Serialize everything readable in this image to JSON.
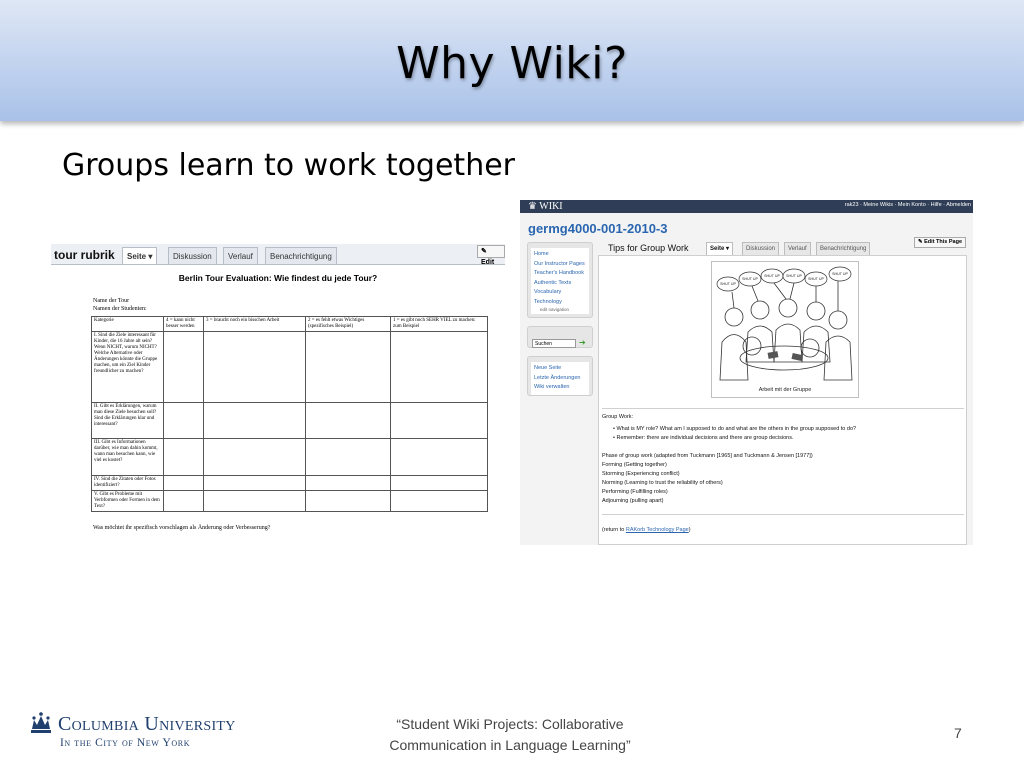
{
  "slide": {
    "title": "Why Wiki?",
    "bullet": "Groups learn to work together",
    "footer_line1": "“Student Wiki Projects:  Collaborative",
    "footer_line2": "Communication in Language Learning”",
    "page_number": "7",
    "logo_line1": "Columbia University",
    "logo_line2": "In the City of New York",
    "colors": {
      "title_band": "#bed1ef",
      "logo": "#1f3f6e",
      "wiki_blue": "#2a66b0"
    }
  },
  "left_screenshot": {
    "page_name": "tour rubrik",
    "tabs": [
      "Seite",
      "Diskussion",
      "Verlauf",
      "Benachrichtigung"
    ],
    "edit_label": "Edit",
    "heading": "Berlin Tour Evaluation: Wie findest du jede Tour?",
    "meta": [
      "Name der Tour",
      "Namen der Studenten:"
    ],
    "table": {
      "headers": [
        "Kategorie",
        "4 = kann nicht besser werden",
        "3 = braucht noch ein bisschen Arbeit",
        "2 = es fehlt etwas Wichtiges (spezifisches Beispiel)",
        "1 = es gibt noch SEHR VIEL zu machen: zum Beispiel"
      ],
      "rows": [
        "I.  Sind die Ziele interessant für Kinder, die 16 Jahre alt sein? Wenn NICHT, warum NICHT?  Welche Alternative oder Änderungen könnte die Gruppe machen, um ein Ziel Kinder freundlicher zu machen?",
        "II.  Gibt es Erklärungen, warum man diese Ziele besuchen soll?  Sind die Erklärungen klar und interessant?",
        "III.  Gibt es Informationen darüber, wie man dahin kommt, wann man besuchen kann, wie viel es kostet?",
        "IV.  Sind die Zitaten oder Fotos identifiziert?",
        "V.  Gibt es Probleme mit Verbformen oder Formen in dem Text?"
      ]
    },
    "footer": "Was möchtet ihr spezifisch vorschlagen als Änderung oder Verbesserung?"
  },
  "right_screenshot": {
    "logo": "WIKI",
    "user_bar": "rak23 · Meine Wikis · Mein Konto · Hilfe · Abmelden",
    "wiki_title": "germg4000-001-2010-3",
    "nav_links": [
      "Home",
      "Our Instructor Pages",
      "Teacher's Handbook",
      "Authentic Texts",
      "Vocabulary",
      "Technology"
    ],
    "edit_navigation": "edit navigation",
    "search_placeholder": "Suchen",
    "tool_links": [
      "Neue Seite",
      "Letzte Änderungen",
      "Wiki verwalten"
    ],
    "page_title": "Tips for Group Work",
    "tabs": [
      "Seite",
      "Diskussion",
      "Verlauf",
      "Benachrichtigung"
    ],
    "edit_label": "Edit This Page",
    "image_caption": "Arbeit mit der Gruppe",
    "bubbles": [
      "SHUT UP",
      "SHUT UP",
      "SHUT UP",
      "SHUT UP",
      "SHUT UP",
      "SHUT UP"
    ],
    "group_work_heading": "Group Work:",
    "bullets": [
      "What is MY role? What am I supposed to do and what are the others in the group supposed to do?",
      "Remember: there are individual decisions and there are group decisions."
    ],
    "phases_heading": "Phase of group work (adapted from Tuckmann [1965] and Tuckmann & Jensen [1977])",
    "phases": [
      "Forming (Getting together)",
      "Storming (Experiencing conflict)",
      "Norming (Learning to trust the reliability of others)",
      "Performing (Fulfilling roles)",
      "Adjourning (pulling apart)"
    ],
    "return_prefix": "(return to ",
    "return_link": "RAKorb Technology Page",
    "return_suffix": ")"
  }
}
